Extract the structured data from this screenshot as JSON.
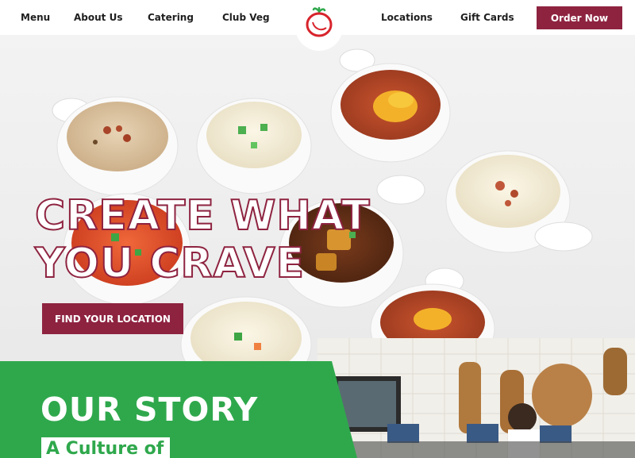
{
  "nav": {
    "left": [
      {
        "label": "Menu"
      },
      {
        "label": "About Us"
      },
      {
        "label": "Catering"
      },
      {
        "label": "Club Veg"
      }
    ],
    "right": [
      {
        "label": "Locations"
      },
      {
        "label": "Gift Cards"
      }
    ],
    "order_label": "Order Now",
    "logo_icon": "tomato-logo-icon"
  },
  "hero": {
    "title_line1": "CREATE WHAT",
    "title_line2": "YOU CRAVE",
    "cta_label": "FIND YOUR LOCATION"
  },
  "story": {
    "title": "OUR STORY",
    "subtitle": "A Culture of"
  },
  "colors": {
    "brand": "#8e2340",
    "green": "#2fa84c",
    "white": "#ffffff"
  }
}
